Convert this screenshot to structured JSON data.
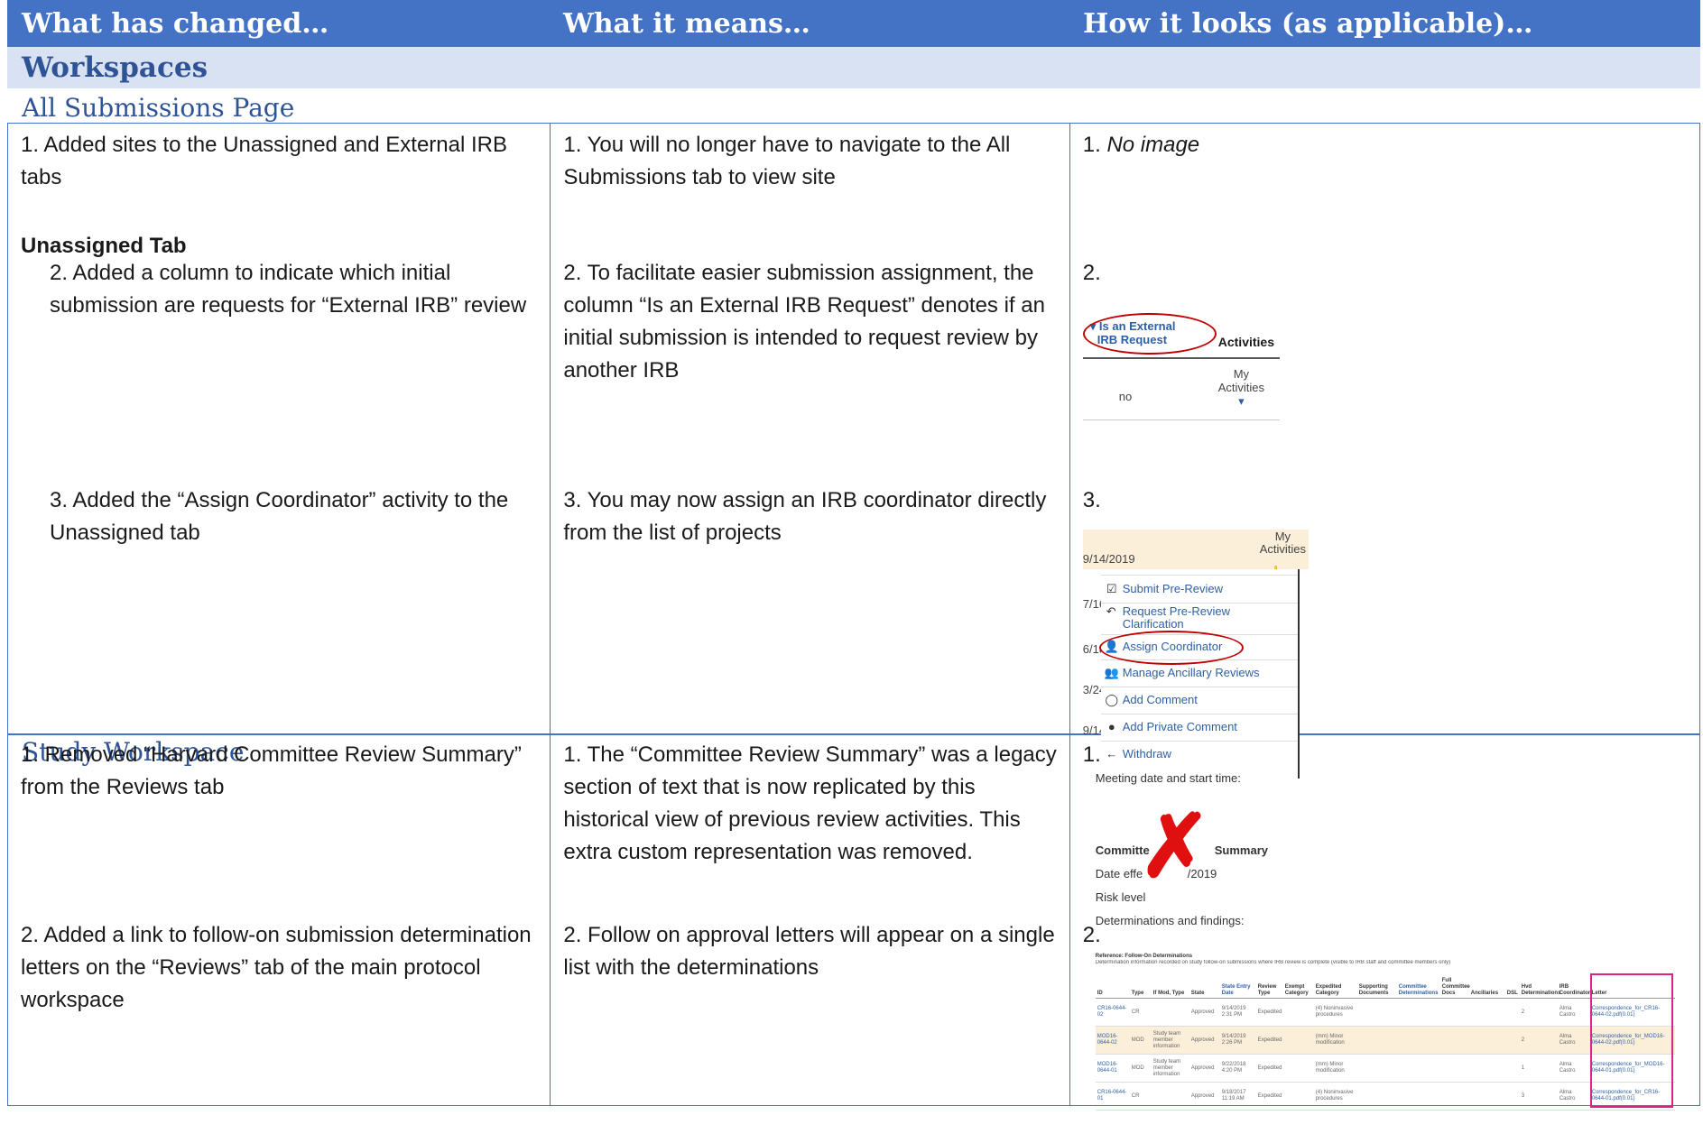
{
  "header": {
    "col1": "What has changed…",
    "col2": "What it means…",
    "col3": "How it looks (as applicable)…"
  },
  "section": "Workspaces",
  "subsections": {
    "all_submissions": "All Submissions Page",
    "study_workspace": "Study Workspace"
  },
  "all_submissions": {
    "row1": {
      "changed": "1. Added sites to the Unassigned and External IRB tabs",
      "means": "1. You will no longer have to navigate to the All Submissions tab to view site",
      "looks_num": "1.",
      "looks_text": "No image"
    },
    "unassigned_tab_label": "Unassigned Tab",
    "row2": {
      "changed": "2. Added a column to indicate which initial submission are requests for “External IRB” review",
      "means": "2. To facilitate easier submission assignment, the column “Is an External IRB Request” denotes if an initial submission is intended to request review by another IRB",
      "looks_num": "2.",
      "img": {
        "col_header": "▾ Is an External IRB Request",
        "col_header_a": "▾ Is an External",
        "col_header_b": "IRB Request",
        "activities": "Activities",
        "value": "no",
        "my_activities_a": "My",
        "my_activities_b": "Activities"
      }
    },
    "row3": {
      "changed": "3. Added the “Assign Coordinator” activity to the Unassigned tab",
      "means": "3. You may now assign an IRB coordinator directly from the list of projects",
      "looks_num": "3.",
      "img": {
        "date": "9/14/2019",
        "my": "My",
        "activities": "Activities",
        "left_dates": [
          "7/16",
          "6/18",
          "3/24",
          "9/14"
        ],
        "menu": [
          {
            "icon": "check-box-icon",
            "label": "Submit Pre-Review"
          },
          {
            "icon": "reply-arrow-icon",
            "label": "Request Pre-Review",
            "label2": "Clarification"
          },
          {
            "icon": "user-plus-icon",
            "label": "Assign Coordinator"
          },
          {
            "icon": "users-icon",
            "label": "Manage Ancillary Reviews"
          },
          {
            "icon": "comment-icon",
            "label": "Add Comment"
          },
          {
            "icon": "comment-filled-icon",
            "label": "Add Private Comment"
          },
          {
            "icon": "arrow-left-icon",
            "label": "Withdraw"
          }
        ]
      }
    }
  },
  "study_workspace": {
    "row1": {
      "changed": "1. Removed “Harvard Committee Review Summary” from the Reviews tab",
      "means": "1. The “Committee Review Summary” was a legacy section of text that is now replicated by this historical view of previous review activities.  This extra custom representation was removed.",
      "looks_num": "1.",
      "img": {
        "meeting": "Meeting date and start time:",
        "summary_a": "Committe",
        "summary_b": "Summary",
        "date_a": "Date effe",
        "date_b": "/2019",
        "risk": "Risk level",
        "determinations": "Determinations and findings:"
      }
    },
    "row2": {
      "changed": "2. Added a link to follow-on submission determination letters on the “Reviews” tab of the main protocol workspace",
      "means": "2. Follow on approval letters will appear on a single list with the determinations",
      "looks_num": "2.",
      "img": {
        "title": "Reference: Follow-On Determinations",
        "subtitle": "Determination information recorded on study follow-on submissions where IRB review is complete (visible to IRB staff and committee members only)",
        "columns": [
          "ID",
          "Type",
          "If Mod, Type",
          "State",
          "State Entry Date",
          "Review Type",
          "Exempt Category",
          "Expedited Category",
          "Supporting Documents",
          "Committee Determinations",
          "Full Committee Docs",
          "Ancillaries",
          "DSL",
          "Hvd Determinations",
          "IRB Coordinator",
          "Letter"
        ],
        "rows": [
          [
            "CR16-0644-02",
            "CR",
            "",
            "Approved",
            "9/14/2019 2:31 PM",
            "Expedited",
            "",
            "(4) Noninvasive procedures",
            "",
            "",
            "",
            "",
            "",
            "2",
            "Alma Castro",
            "Correspondence_for_CR16-0644-02.pdf(0.01)"
          ],
          [
            "MOD16-0644-02",
            "MOD",
            "Study team member information",
            "Approved",
            "9/14/2019 2:26 PM",
            "Expedited",
            "",
            "(mm) Minor modification",
            "",
            "",
            "",
            "",
            "",
            "2",
            "Alma Castro",
            "Correspondence_for_MOD16-0644-02.pdf(0.01)"
          ],
          [
            "MOD16-0644-01",
            "MOD",
            "Study team member information",
            "Approved",
            "9/22/2018 4:20 PM",
            "Expedited",
            "",
            "(mm) Minor modification",
            "",
            "",
            "",
            "",
            "",
            "1",
            "Alma Castro",
            "Correspondence_for_MOD16-0644-01.pdf(0.01)"
          ],
          [
            "CR16-0644-01",
            "CR",
            "",
            "Approved",
            "9/18/2017 11:19 AM",
            "Expedited",
            "",
            "(4) Noninvasive procedures",
            "",
            "",
            "",
            "",
            "",
            "3",
            "Alma Castro",
            "Correspondence_for_CR16-0644-01.pdf(0.01)"
          ]
        ]
      }
    }
  },
  "colors": {
    "header_bg": "#4472c4",
    "section_bg": "#d9e2f3",
    "subsection_text": "#2f5496",
    "highlight_red": "#c00000",
    "link_blue": "#2e5fa6",
    "letter_box": "#e0218a"
  }
}
